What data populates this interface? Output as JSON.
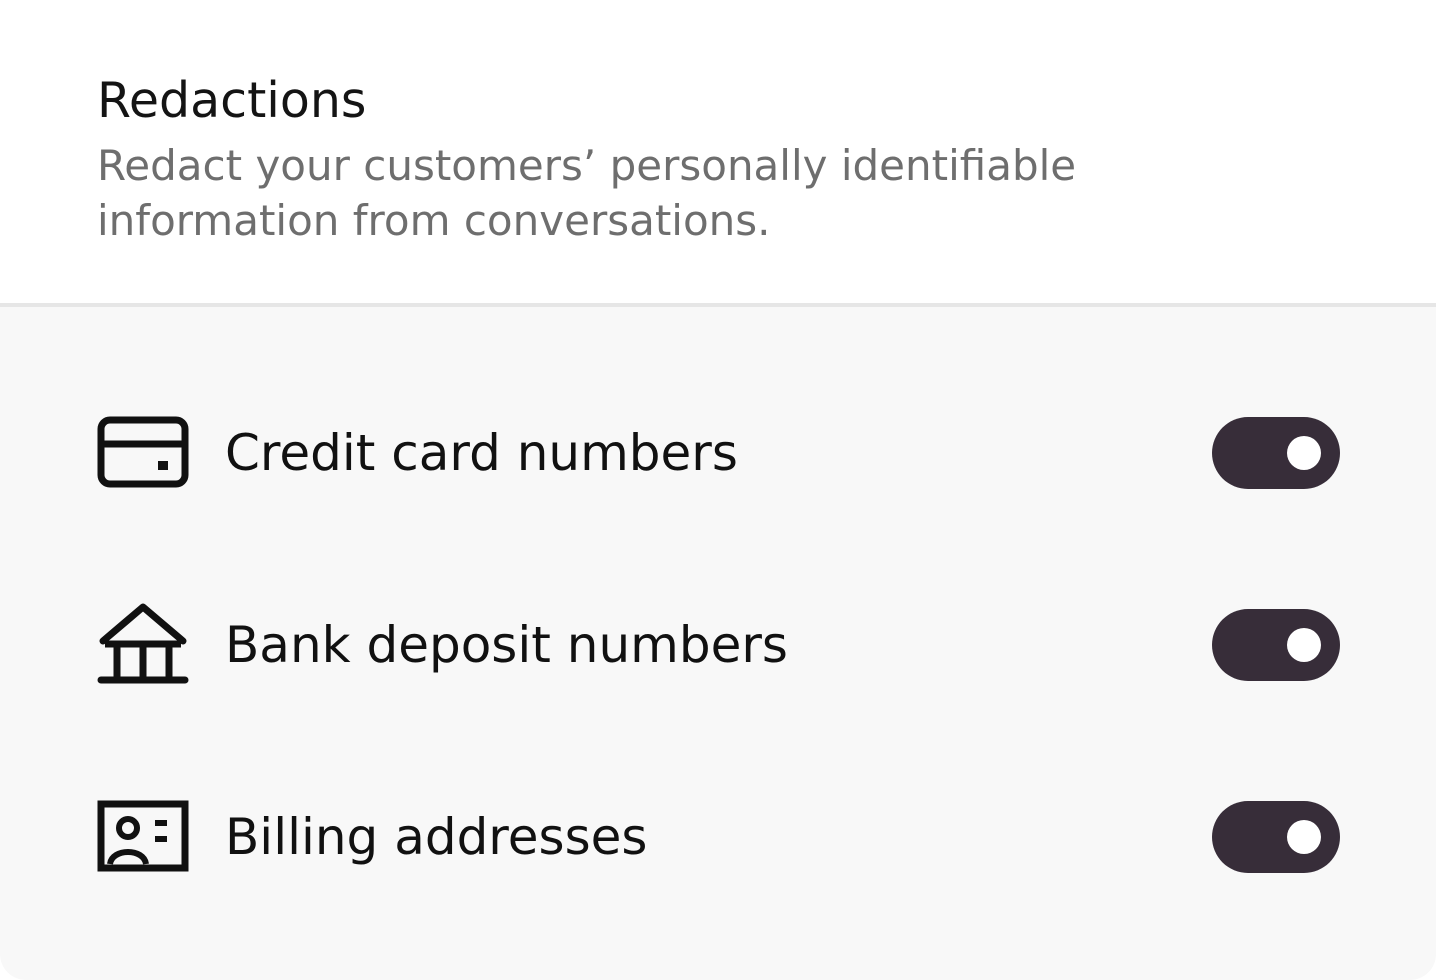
{
  "header": {
    "title": "Redactions",
    "subtitle": "Redact your customers’ personally identifiable information from conversations."
  },
  "redactions": [
    {
      "icon": "credit-card-icon",
      "label": "Credit card numbers",
      "enabled": true
    },
    {
      "icon": "bank-icon",
      "label": "Bank deposit numbers",
      "enabled": true
    },
    {
      "icon": "id-card-icon",
      "label": "Billing addresses",
      "enabled": true
    }
  ],
  "colors": {
    "toggle_on": "#372d39",
    "knob": "#ffffff",
    "panel_background": "#f8f8f8",
    "divider": "#e6e6e6",
    "title_text": "#141414",
    "subtitle_text": "#6e6e6e"
  }
}
